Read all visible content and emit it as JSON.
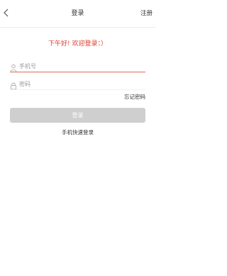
{
  "header": {
    "title": "登录",
    "right_action": "注册",
    "back_icon": "chevron-left-icon"
  },
  "greeting": "下午好! 欢迎登录：）",
  "form": {
    "phone": {
      "placeholder": "手机号",
      "icon": "user-icon"
    },
    "password": {
      "placeholder": "密码",
      "icon": "lock-icon"
    },
    "forgot_label": "忘记密码",
    "login_label": "登录",
    "quick_login_label": "手机快速登录"
  },
  "colors": {
    "accent": "#e03a2a",
    "underline_active": "#e36a5c",
    "button_disabled": "#cfcfcf"
  }
}
